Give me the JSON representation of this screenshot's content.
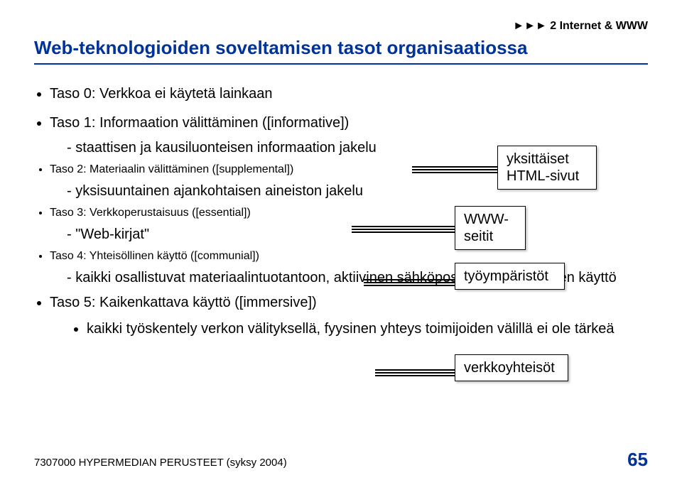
{
  "header": {
    "breadcrumb": "►►► 2 Internet & WWW"
  },
  "title": "Web-teknologioiden soveltamisen tasot organisaatiossa",
  "levels": {
    "taso0": "Taso 0: Verkkoa ei käytetä lainkaan",
    "taso1": "Taso 1: Informaation välittäminen ([informative])",
    "taso1_sub": "staattisen ja kausiluonteisen informaation jakelu",
    "taso2": "Taso 2: Materiaalin välittäminen ([supplemental])",
    "taso2_sub": "yksisuuntainen ajankohtaisen aineiston jakelu",
    "taso3": "Taso 3: Verkkoperustaisuus ([essential])",
    "taso3_sub": "\"Web-kirjat\"",
    "taso4": "Taso 4: Yhteisöllinen käyttö ([communial])",
    "taso4_sub": "kaikki osallistuvat materiaalintuotantoon, aktiivinen sähköpostin yms. välineiden käyttö",
    "taso5": "Taso 5: Kaikenkattava käyttö ([immersive])",
    "taso5_sub": "kaikki työskentely verkon välityksellä, fyysinen yhteys toimijoiden välillä ei ole tärkeä"
  },
  "callouts": {
    "c1": "yksittäiset\nHTML-sivut",
    "c2": "WWW-\nseitit",
    "c3": "työympäristöt",
    "c4": "verkkoyhteisöt"
  },
  "footer": {
    "course": "7307000 HYPERMEDIAN PERUSTEET (syksy 2004)",
    "page": "65"
  }
}
